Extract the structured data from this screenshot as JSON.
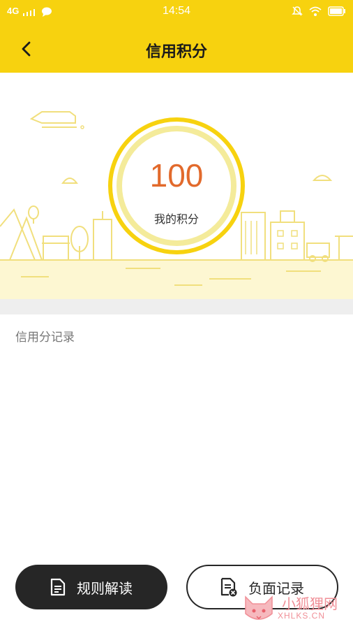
{
  "status_bar": {
    "network": "4G",
    "time": "14:54"
  },
  "nav": {
    "title": "信用积分",
    "back_icon": "chevron-left-icon"
  },
  "score": {
    "value": "100",
    "label": "我的积分"
  },
  "records": {
    "title": "信用分记录"
  },
  "actions": {
    "rules_label": "规则解读",
    "rules_icon": "document-icon",
    "negative_label": "负面记录",
    "negative_icon": "document-warning-icon"
  },
  "watermark": {
    "name": "小狐狸网",
    "domain": "XHLKS.CN"
  },
  "colors": {
    "brand_yellow": "#f7d20f",
    "score_orange": "#e26a2c",
    "dark_button": "#262626"
  }
}
